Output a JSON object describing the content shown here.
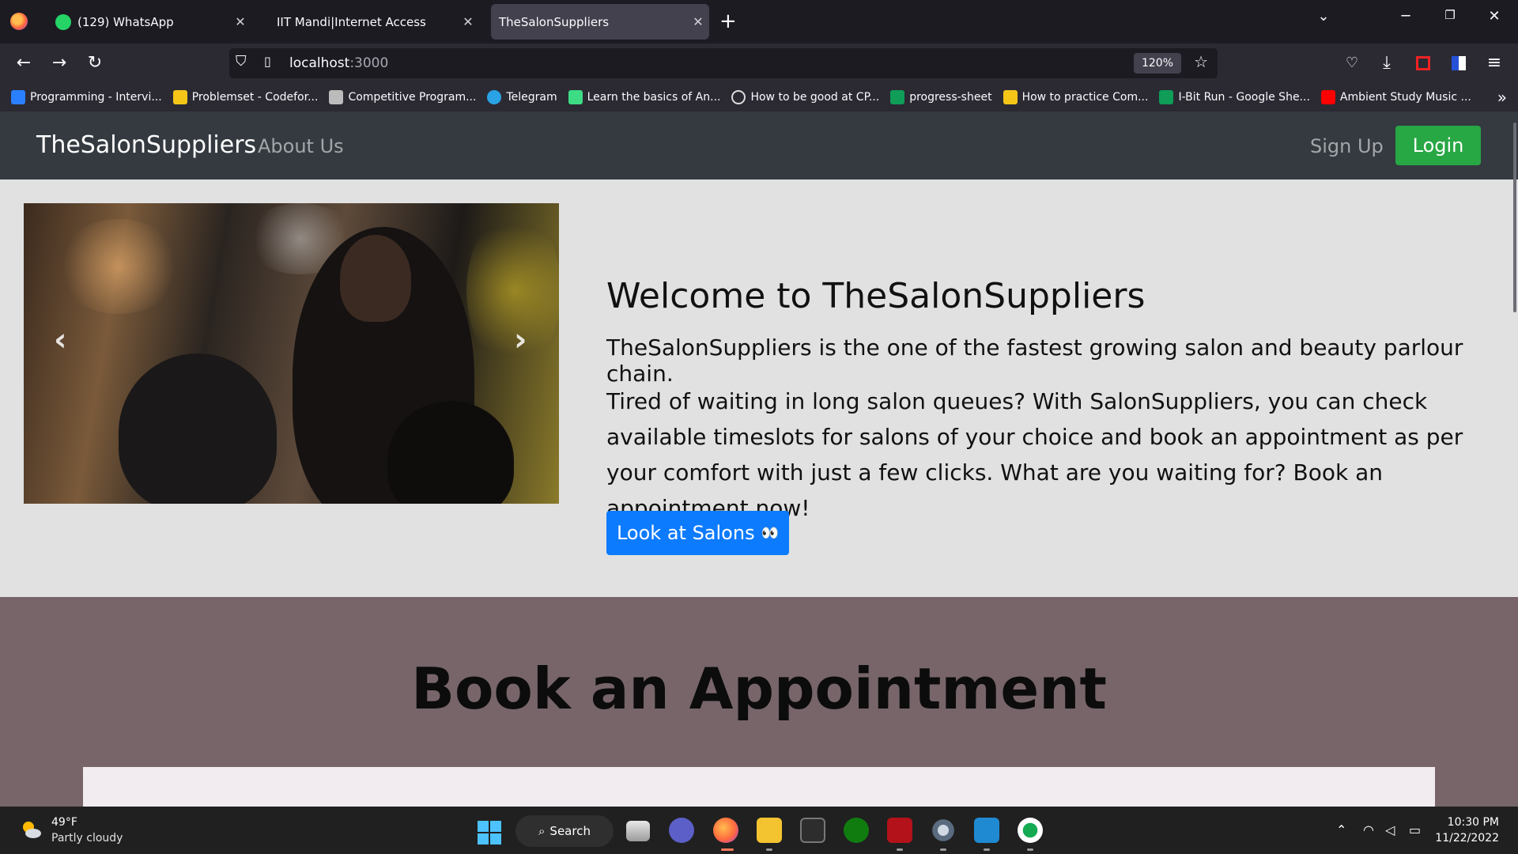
{
  "browser": {
    "tabs": [
      {
        "title": "(129) WhatsApp",
        "active": false
      },
      {
        "title": "IIT Mandi|Internet Access",
        "active": false
      },
      {
        "title": "TheSalonSuppliers",
        "active": true
      }
    ],
    "url_host": "localhost",
    "url_port": ":3000",
    "zoom": "120%",
    "bookmarks": [
      {
        "label": "Programming - Intervi...",
        "color": "#2a7fff"
      },
      {
        "label": "Problemset - Codefor...",
        "color": "#f5c518"
      },
      {
        "label": "Competitive Program...",
        "color": "#bbbbbb"
      },
      {
        "label": "Telegram",
        "color": "#2aa3e6"
      },
      {
        "label": "Learn the basics of An...",
        "color": "#3ddc84"
      },
      {
        "label": "How to be good at CP...",
        "color": "#dddddd"
      },
      {
        "label": "progress-sheet",
        "color": "#0f9d58"
      },
      {
        "label": "How to practice Com...",
        "color": "#f5c518"
      },
      {
        "label": "I-Bit Run - Google She...",
        "color": "#0f9d58"
      },
      {
        "label": "Ambient Study Music ...",
        "color": "#ff0000"
      }
    ]
  },
  "site": {
    "brand": "TheSalonSuppliers",
    "nav_about": "About Us",
    "nav_signup": "Sign Up",
    "login_label": "Login",
    "hero_title": "Welcome to TheSalonSuppliers",
    "hero_subtitle": "TheSalonSuppliers is the one of the fastest growing salon and beauty parlour chain.",
    "hero_paragraph": "Tired of waiting in long salon queues? With SalonSuppliers, you can check available timeslots for salons of your choice and book an appointment as per your comfort with just a few clicks. What are you waiting for? Book an appointment now!",
    "salons_button": "Look at Salons",
    "salons_button_emoji": "👀",
    "book_title": "Book an Appointment",
    "accent_login": "#28a745",
    "accent_primary": "#0d7bfd"
  },
  "taskbar": {
    "weather_temp": "49°F",
    "weather_desc": "Partly cloudy",
    "search_label": "Search",
    "time": "10:30 PM",
    "date": "11/22/2022"
  }
}
